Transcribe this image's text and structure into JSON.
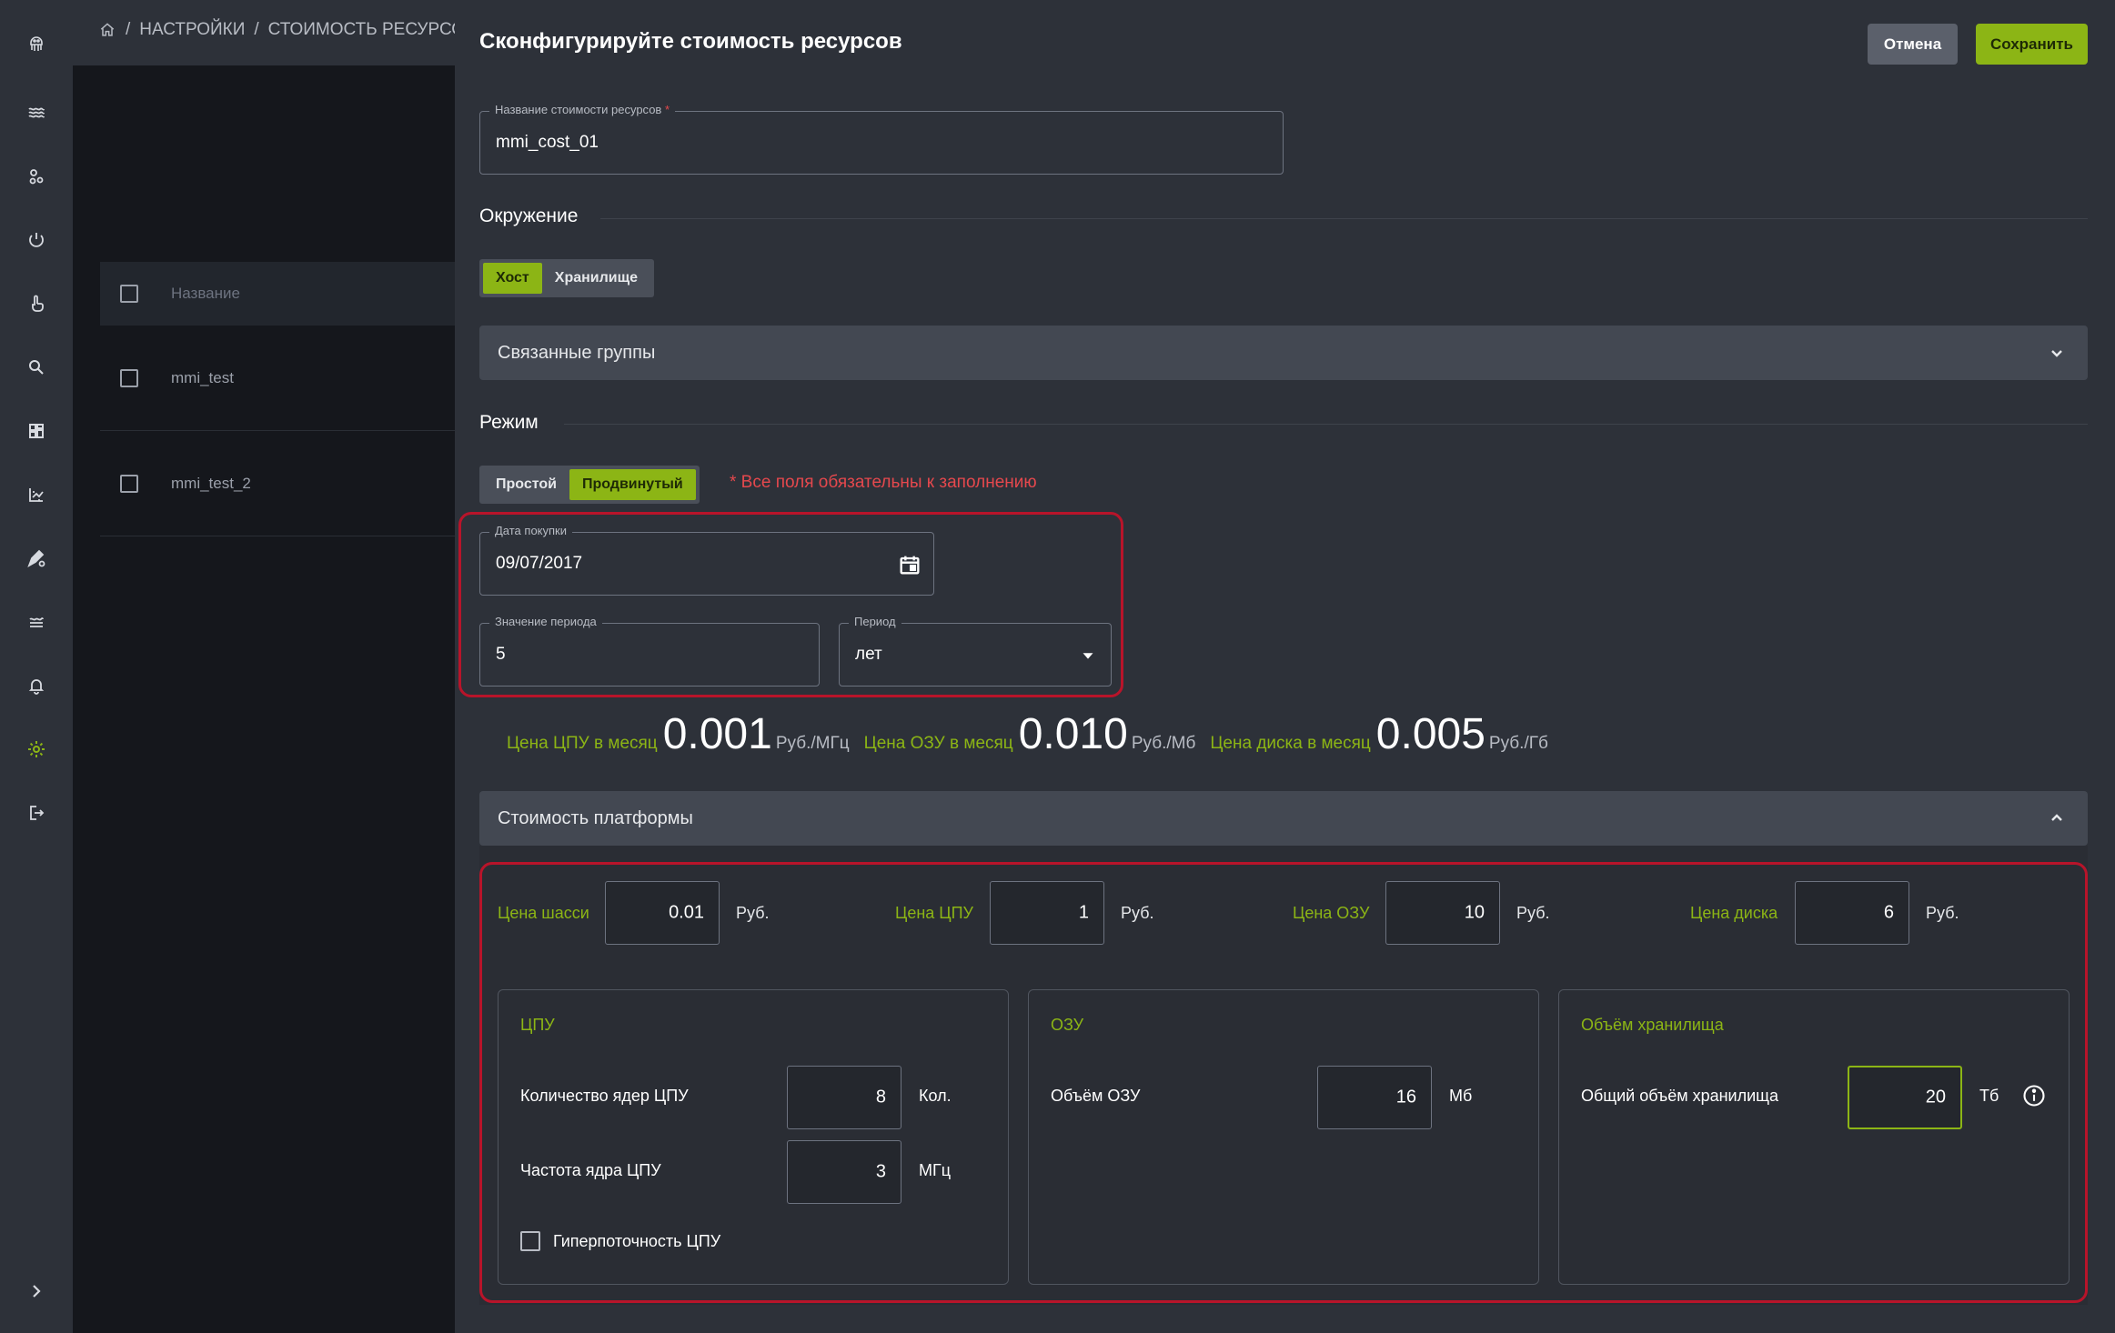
{
  "breadcrumb": {
    "sep": "/",
    "settings": "НАСТРОЙКИ",
    "current": "СТОИМОСТЬ РЕСУРСОВ"
  },
  "list": {
    "column_name": "Название",
    "rows": [
      {
        "name": "mmi_test"
      },
      {
        "name": "mmi_test_2"
      }
    ]
  },
  "drawer": {
    "title": "Сконфигурируйте стоимость ресурсов",
    "cancel_label": "Отмена",
    "save_label": "Сохранить"
  },
  "name_field": {
    "label": "Название стоимости ресурсов",
    "required_mark": "*",
    "value": "mmi_cost_01"
  },
  "environment": {
    "label": "Окружение",
    "options": [
      "Хост",
      "Хранилище"
    ],
    "selected": "Хост"
  },
  "related_groups": {
    "label": "Связанные группы"
  },
  "mode": {
    "label": "Режим",
    "options": [
      "Простой",
      "Продвинутый"
    ],
    "selected": "Продвинутый",
    "required_note": "* Все поля обязательны к заполнению"
  },
  "purchase_date": {
    "label": "Дата покупки",
    "value": "09/07/2017"
  },
  "period_value": {
    "label": "Значение периода",
    "value": "5"
  },
  "period": {
    "label": "Период",
    "value": "лет"
  },
  "monthly_prices": {
    "cpu": {
      "label": "Цена ЦПУ в месяц",
      "value": "0.001",
      "unit": "Руб./МГц"
    },
    "ram": {
      "label": "Цена ОЗУ в месяц",
      "value": "0.010",
      "unit": "Руб./Мб"
    },
    "disk": {
      "label": "Цена диска в месяц",
      "value": "0.005",
      "unit": "Руб./Гб"
    }
  },
  "platform": {
    "title": "Стоимость платформы",
    "chassis": {
      "label": "Цена шасси",
      "value": "0.01",
      "unit": "Руб."
    },
    "cpu": {
      "label": "Цена ЦПУ",
      "value": "1",
      "unit": "Руб."
    },
    "ram": {
      "label": "Цена ОЗУ",
      "value": "10",
      "unit": "Руб."
    },
    "disk": {
      "label": "Цена диска",
      "value": "6",
      "unit": "Руб."
    }
  },
  "cpu_card": {
    "title": "ЦПУ",
    "cores": {
      "label": "Количество ядер ЦПУ",
      "value": "8",
      "unit": "Кол."
    },
    "freq": {
      "label": "Частота ядра ЦПУ",
      "value": "3",
      "unit": "МГц"
    },
    "hyperthreading": {
      "label": "Гиперпоточность ЦПУ",
      "checked": false
    }
  },
  "ram_card": {
    "title": "ОЗУ",
    "size": {
      "label": "Объём ОЗУ",
      "value": "16",
      "unit": "Мб"
    }
  },
  "storage_card": {
    "title": "Объём хранилища",
    "total": {
      "label": "Общий объём хранилища",
      "value": "20",
      "unit": "Тб"
    }
  },
  "colors": {
    "accent": "#8cb515",
    "danger": "#b8142a",
    "panel": "#2d3139"
  },
  "sidebar_icons": [
    "logo-icon",
    "waves-icon",
    "nodes-icon",
    "power-icon",
    "hand-icon",
    "search-icon",
    "dashboard-icon",
    "chart-icon",
    "pen-settings-icon",
    "layers-icon",
    "bell-icon",
    "settings-icon",
    "logout-icon",
    "expand-icon"
  ]
}
